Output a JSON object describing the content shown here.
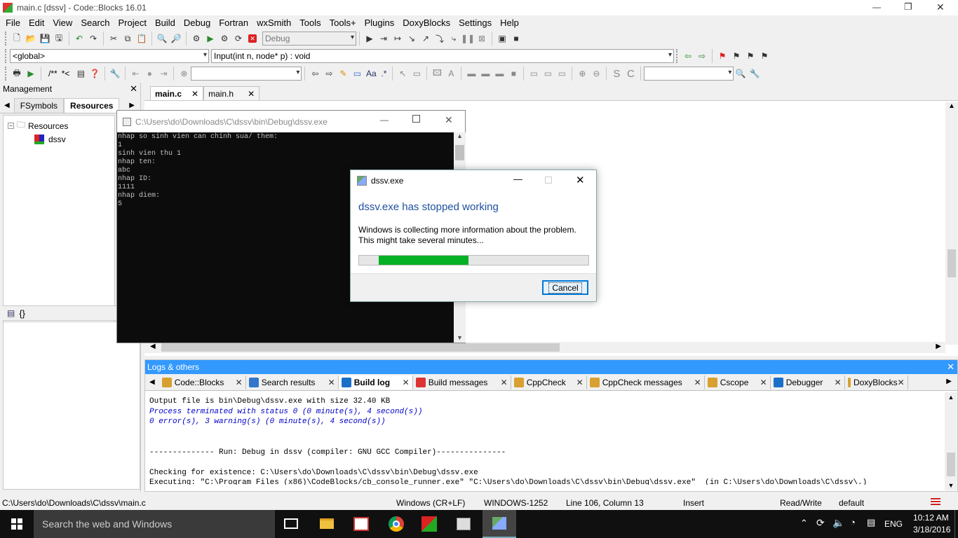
{
  "window": {
    "title": "main.c [dssv] - Code::Blocks 16.01",
    "min": "—",
    "max": "❐",
    "close": "✕"
  },
  "menu": [
    "File",
    "Edit",
    "View",
    "Search",
    "Project",
    "Build",
    "Debug",
    "Fortran",
    "wxSmith",
    "Tools",
    "Tools+",
    "Plugins",
    "DoxyBlocks",
    "Settings",
    "Help"
  ],
  "toolbar": {
    "build_target": "Debug",
    "scope": "<global>",
    "function": "Input(int n, node* p) : void",
    "comment": "/**",
    "comment2": "*<",
    "regex": ".*"
  },
  "management": {
    "title": "Management",
    "tabs": [
      "FSymbols",
      "Resources"
    ],
    "tree_root": "Resources",
    "tree_child": "dssv",
    "lower_label": "{}"
  },
  "editor": {
    "tabs": [
      {
        "label": "main.c"
      },
      {
        "label": "main.h"
      }
    ]
  },
  "console": {
    "title": "C:\\Users\\do\\Downloads\\C\\dssv\\bin\\Debug\\dssv.exe",
    "lines": [
      "nhap so sinh vien can chinh sua/ them:",
      "1",
      "sinh vien thu 1",
      "nhap ten:",
      "abc",
      "nhap ID:",
      "1111",
      "nhap diem:",
      "5"
    ]
  },
  "dialog": {
    "title": "dssv.exe",
    "heading": "dssv.exe has stopped working",
    "body1": "Windows is collecting more information about the problem.",
    "body2": "This might take several minutes...",
    "progress": 0.39,
    "cancel": "Cancel"
  },
  "logs": {
    "title": "Logs & others",
    "tabs": [
      "Code::Blocks",
      "Search results",
      "Build log",
      "Build messages",
      "CppCheck",
      "CppCheck messages",
      "Cscope",
      "Debugger",
      "DoxyBlocks"
    ],
    "lines": [
      {
        "text": "Output file is bin\\Debug\\dssv.exe with size 32.40 KB",
        "style": "normal"
      },
      {
        "text": "Process terminated with status 0 (0 minute(s), 4 second(s))",
        "style": "blue"
      },
      {
        "text": "0 error(s), 3 warning(s) (0 minute(s), 4 second(s))",
        "style": "blue"
      },
      {
        "text": "",
        "style": "normal"
      },
      {
        "text": "",
        "style": "normal"
      },
      {
        "text": "-------------- Run: Debug in dssv (compiler: GNU GCC Compiler)---------------",
        "style": "normal"
      },
      {
        "text": "",
        "style": "normal"
      },
      {
        "text": "Checking for existence: C:\\Users\\do\\Downloads\\C\\dssv\\bin\\Debug\\dssv.exe",
        "style": "normal"
      },
      {
        "text": "Executing: \"C:\\Program Files (x86)\\CodeBlocks/cb_console_runner.exe\" \"C:\\Users\\do\\Downloads\\C\\dssv\\bin\\Debug\\dssv.exe\"  (in C:\\Users\\do\\Downloads\\C\\dssv\\.)",
        "style": "normal"
      }
    ]
  },
  "status": {
    "path": "C:\\Users\\do\\Downloads\\C\\dssv\\main.c",
    "eol": "Windows (CR+LF)",
    "encoding": "WINDOWS-1252",
    "pos": "Line 106, Column 13",
    "mode": "Insert",
    "rw": "Read/Write",
    "profile": "default"
  },
  "taskbar": {
    "search": "Search the web and Windows",
    "lang": "ENG",
    "time": "10:12 AM",
    "date": "3/18/2016"
  },
  "colors": {
    "accent": "#3399ff",
    "progress": "#06b025",
    "dialog_heading": "#1e50a0",
    "log_blue": "#0000c8"
  }
}
